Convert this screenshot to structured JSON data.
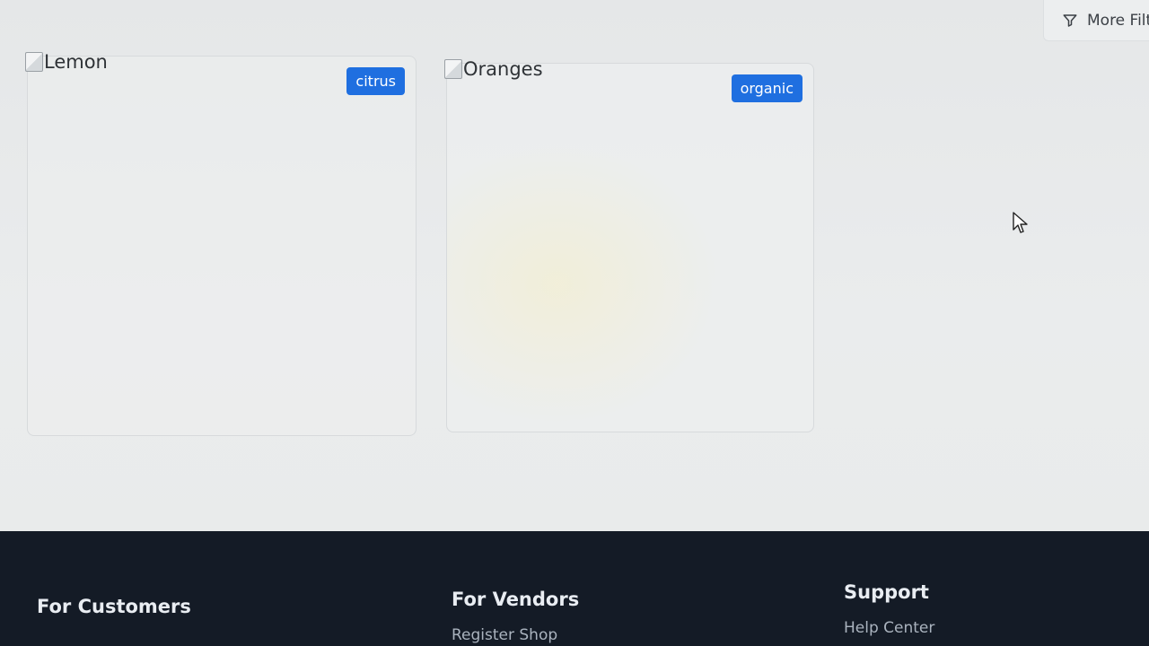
{
  "toolbar": {
    "more_filters_label": "More Filte",
    "more_filters_icon": "filter-icon"
  },
  "products": [
    {
      "image_alt": "Lemon",
      "tag": "citrus"
    },
    {
      "image_alt": "Oranges",
      "tag": "organic"
    }
  ],
  "footer": {
    "customers": {
      "heading": "For Customers"
    },
    "vendors": {
      "heading": "For Vendors",
      "links": [
        "Register Shop"
      ]
    },
    "support": {
      "heading": "Support",
      "links": [
        "Help Center"
      ]
    }
  },
  "colors": {
    "badge": "#1f6fe0",
    "footer_bg": "#141b26",
    "page_bg": "#e7e9ea"
  }
}
